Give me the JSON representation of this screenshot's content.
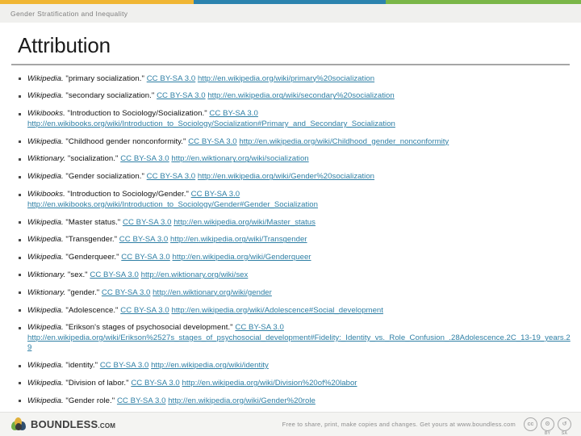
{
  "topbar": {
    "segments": [
      {
        "name": "yellow",
        "color": "#f0b634"
      },
      {
        "name": "blue",
        "color": "#2b83ae"
      },
      {
        "name": "green",
        "color": "#7ab648"
      }
    ]
  },
  "chapter": {
    "title": "Gender Stratification and Inequality"
  },
  "slide": {
    "title": "Attribution"
  },
  "references": [
    {
      "source": "Wikipedia.",
      "work": "\"primary socialization.\"",
      "license": "CC BY-SA 3.0",
      "url": "http://en.wikipedia.org/wiki/primary%20socialization",
      "url_on_new_line": false
    },
    {
      "source": "Wikipedia.",
      "work": "\"secondary socialization.\"",
      "license": "CC BY-SA 3.0",
      "url": "http://en.wikipedia.org/wiki/secondary%20socialization",
      "url_on_new_line": false
    },
    {
      "source": "Wikibooks.",
      "work": "\"Introduction to Sociology/Socialization.\"",
      "license": "CC BY-SA 3.0",
      "url": "http://en.wikibooks.org/wiki/Introduction_to_Sociology/Socialization#Primary_and_Secondary_Socialization",
      "url_on_new_line": true
    },
    {
      "source": "Wikipedia.",
      "work": "\"Childhood gender nonconformity.\"",
      "license": "CC BY-SA 3.0",
      "url": "http://en.wikipedia.org/wiki/Childhood_gender_nonconformity",
      "url_on_new_line": false
    },
    {
      "source": "Wiktionary.",
      "work": "\"socialization.\"",
      "license": "CC BY-SA 3.0",
      "url": "http://en.wiktionary.org/wiki/socialization",
      "url_on_new_line": false
    },
    {
      "source": "Wikipedia.",
      "work": "\"Gender socialization.\"",
      "license": "CC BY-SA 3.0",
      "url": "http://en.wikipedia.org/wiki/Gender%20socialization",
      "url_on_new_line": false
    },
    {
      "source": "Wikibooks.",
      "work": "\"Introduction to Sociology/Gender.\"",
      "license": "CC BY-SA 3.0",
      "url": "http://en.wikibooks.org/wiki/Introduction_to_Sociology/Gender#Gender_Socialization",
      "url_on_new_line": true
    },
    {
      "source": "Wikipedia.",
      "work": "\"Master status.\"",
      "license": "CC BY-SA 3.0",
      "url": "http://en.wikipedia.org/wiki/Master_status",
      "url_on_new_line": false
    },
    {
      "source": "Wikipedia.",
      "work": "\"Transgender.\"",
      "license": "CC BY-SA 3.0",
      "url": "http://en.wikipedia.org/wiki/Transgender",
      "url_on_new_line": false
    },
    {
      "source": "Wikipedia.",
      "work": "\"Genderqueer.\"",
      "license": "CC BY-SA 3.0",
      "url": "http://en.wikipedia.org/wiki/Genderqueer",
      "url_on_new_line": false
    },
    {
      "source": "Wiktionary.",
      "work": "\"sex.\"",
      "license": "CC BY-SA 3.0",
      "url": "http://en.wiktionary.org/wiki/sex",
      "url_on_new_line": false
    },
    {
      "source": "Wiktionary.",
      "work": "\"gender.\"",
      "license": "CC BY-SA 3.0",
      "url": "http://en.wiktionary.org/wiki/gender",
      "url_on_new_line": false
    },
    {
      "source": "Wikipedia.",
      "work": "\"Adolescence.\"",
      "license": "CC BY-SA 3.0",
      "url": "http://en.wikipedia.org/wiki/Adolescence#Social_development",
      "url_on_new_line": false
    },
    {
      "source": "Wikipedia.",
      "work": "\"Erikson's stages of psychosocial development.\"",
      "license": "CC BY-SA 3.0",
      "url": "http://en.wikipedia.org/wiki/Erikson%2527s_stages_of_psychosocial_development#Fidelity:_Identity_vs._Role_Confusion_.28Adolescence.2C_13-19_years.29",
      "url_on_new_line": true
    },
    {
      "source": "Wikipedia.",
      "work": "\"identity.\"",
      "license": "CC BY-SA 3.0",
      "url": "http://en.wikipedia.org/wiki/identity",
      "url_on_new_line": false
    },
    {
      "source": "Wikipedia.",
      "work": "\"Division of labor.\"",
      "license": "CC BY-SA 3.0",
      "url": "http://en.wikipedia.org/wiki/Division%20of%20labor",
      "url_on_new_line": false
    },
    {
      "source": "Wikipedia.",
      "work": "\"Gender role.\"",
      "license": "CC BY-SA 3.0",
      "url": "http://en.wikipedia.org/wiki/Gender%20role",
      "url_on_new_line": false
    }
  ],
  "footer": {
    "brand_name": "BOUNDLESS",
    "brand_suffix": ".COM",
    "note": "Free to share, print, make copies and changes. Get yours at www.boundless.com",
    "badges": [
      {
        "name": "cc",
        "glyph": "cc",
        "sub": ""
      },
      {
        "name": "by",
        "glyph": "ʘ",
        "sub": "BY"
      },
      {
        "name": "sa",
        "glyph": "↺",
        "sub": "SA"
      }
    ]
  }
}
